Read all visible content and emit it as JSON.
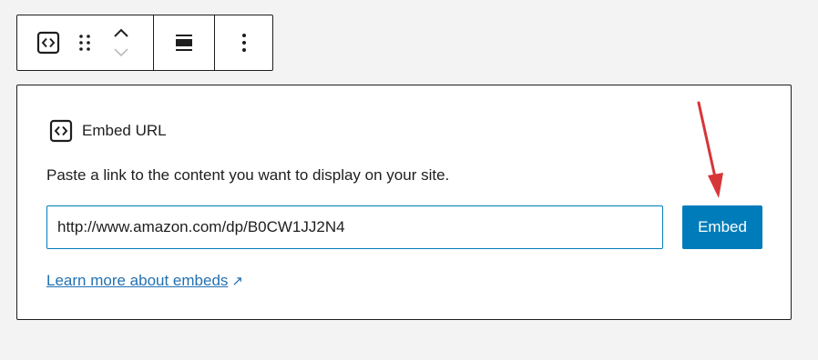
{
  "toolbar": {
    "block_icon": "embed-code-icon",
    "drag_icon": "drag-handle-icon",
    "move_up_icon": "chevron-up-icon",
    "move_down_icon": "chevron-down-icon",
    "align_icon": "align-wide-icon",
    "options_icon": "more-vertical-icon"
  },
  "embed": {
    "title": "Embed URL",
    "instructions": "Paste a link to the content you want to display on your site.",
    "url_value": "http://www.amazon.com/dp/B0CW1JJ2N4",
    "button_label": "Embed",
    "learn_more": "Learn more about embeds",
    "learn_more_icon": "↗"
  },
  "colors": {
    "accent": "#007cba",
    "link": "#2271b1",
    "annotation_arrow": "#d63638"
  }
}
